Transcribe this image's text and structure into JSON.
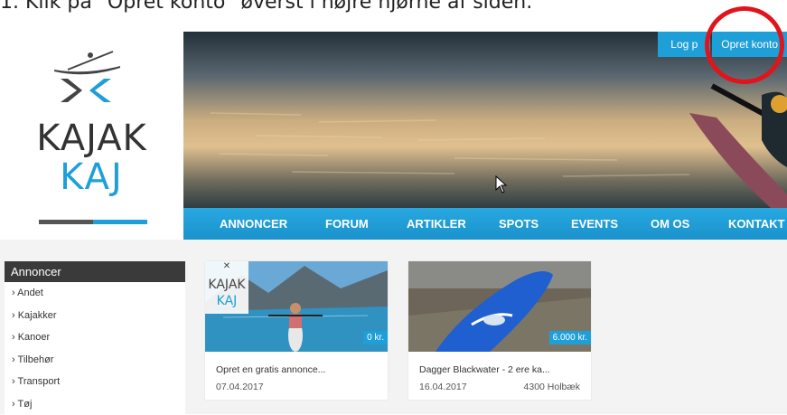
{
  "instruction": "1. Klik på \"Opret konto\" øverst i højre hjørne af siden.",
  "logo": {
    "line1": "KAJAK",
    "line2": "KAJ"
  },
  "top_buttons": {
    "login": "Log p",
    "register": "Opret konto"
  },
  "nav": [
    {
      "label": "ANNONCER"
    },
    {
      "label": "FORUM"
    },
    {
      "label": "ARTIKLER"
    },
    {
      "label": "SPOTS"
    },
    {
      "label": "EVENTS"
    },
    {
      "label": "OM OS"
    },
    {
      "label": "KONTAKT"
    }
  ],
  "sidebar": {
    "header": "Annoncer",
    "items": [
      {
        "label": "› Andet"
      },
      {
        "label": "› Kajakker"
      },
      {
        "label": "› Kanoer"
      },
      {
        "label": "› Tilbehør"
      },
      {
        "label": "› Transport"
      },
      {
        "label": "› Tøj"
      }
    ]
  },
  "cards": [
    {
      "logo_line1": "KAJAK",
      "logo_line2": "KAJ",
      "price": "0 kr.",
      "title": "Opret en gratis annonce...",
      "date": "07.04.2017",
      "location": ""
    },
    {
      "price": "6.000 kr.",
      "title": "Dagger Blackwater - 2 ere ka...",
      "date": "16.04.2017",
      "location": "4300 Holbæk"
    }
  ],
  "colors": {
    "accent": "#1e9fd8",
    "highlight": "#e1141b",
    "sidebar_header": "#3a3a3a"
  }
}
